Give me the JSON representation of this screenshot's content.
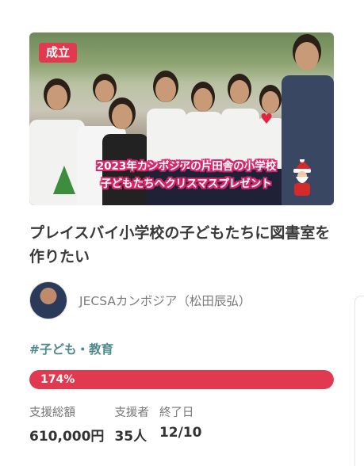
{
  "card": {
    "badge": "成立",
    "image_caption_line1": "2023年カンボジアの片田舎の小学校",
    "image_caption_line2": "子どもたちへクリスマスプレゼント",
    "title": "プレイスバイ小学校の子どもたちに図書室を作りたい",
    "owner_name": "JECSAカンボジア（松田辰弘）",
    "tag": "#子ども・教育",
    "progress_percent_label": "174%",
    "progress_fraction": 1.0,
    "stats": [
      {
        "label": "支援総額",
        "value": "610,000円"
      },
      {
        "label": "支援者",
        "value": "35人"
      },
      {
        "label": "終了日",
        "value": "12/10"
      }
    ]
  },
  "colors": {
    "accent": "#e13950",
    "tag": "#4e8a8c"
  }
}
